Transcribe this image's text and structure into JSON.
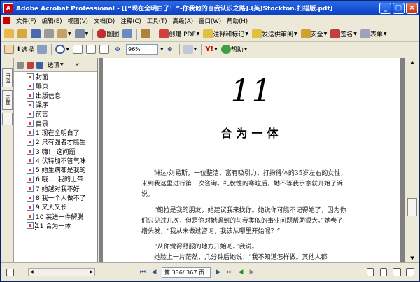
{
  "window": {
    "title": "Adobe Acrobat Professional - [[“现在全明白了！”-你我他的自我认识之路].(英)Stockton.扫描版.pdf]",
    "app_icon": "A"
  },
  "menu": [
    "文件(F)",
    "编辑(E)",
    "视图(V)",
    "文档(D)",
    "注释(C)",
    "工具(T)",
    "高级(A)",
    "窗口(W)",
    "帮助(H)"
  ],
  "toolbar1": {
    "shengtu": "图图",
    "create_pdf": "创建 PDF",
    "comment": "注释和标记",
    "send_review": "发送供审阅",
    "security": "安全",
    "sign": "签名",
    "forms": "表单"
  },
  "toolbar2": {
    "select": "选择",
    "zoom_value": "96%",
    "help": "帮助"
  },
  "bookmarks": {
    "options_label": "选项",
    "items": [
      "封面",
      "扉页",
      "出版信息",
      "译序",
      "前言",
      "目录",
      "1 现在全明白了",
      "2 只有强者才能生",
      "3 嗨！ 这问题",
      "4 伏特加不管气味",
      "5 她生病都是我的",
      "6 哦.....我的上帝",
      "7 她越对我不好",
      "8 我一个人做不了",
      "9 又大又长",
      "10 装进一件解脱",
      "11 合为一体"
    ],
    "selected_index": 16
  },
  "page": {
    "chapter_number": "11",
    "chapter_title": "合为一体",
    "paragraphs": [
      "琳达·刘易斯，一位整洁，富有吸引力，打扮得体的35岁左右的女性，来到我这里进行第一次咨询。礼貌性的寒暄后，她不等我示意就开始了诉说。",
      "“鲍拉是我的朋友，她建议我来找你。她说你可能不记得她了，因为你们只见过几次，但是你对她遇到的与我类似的事业问题帮助很大。”她卷了一绺头发，“我从未做过咨询，我该从哪里开始呢？”",
      "“从你觉得舒服的地方开始吧。”我说。",
      "她脸上一片茫然，几分钟后她说：“我不知道怎样做。其他人都"
    ]
  },
  "status": {
    "page_display": "第 336/ 367 页"
  },
  "colors": {
    "titlebar": "#0a3fc2",
    "accent": "#2a6ae8"
  }
}
